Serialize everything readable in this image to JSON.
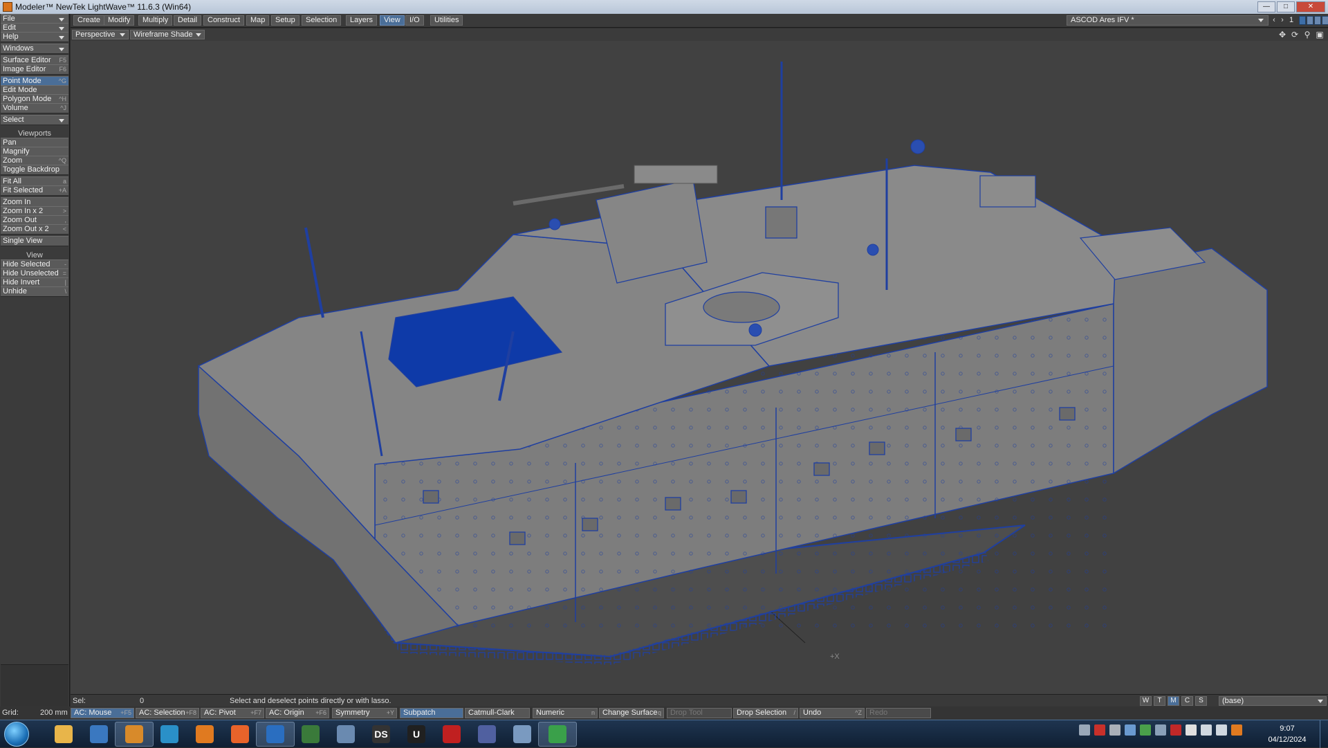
{
  "window": {
    "title": "Modeler™ NewTek LightWave™ 11.6.3 (Win64)",
    "controls": [
      "minimize",
      "maximize",
      "close"
    ]
  },
  "left_toolbar": {
    "menus": [
      {
        "label": "File"
      },
      {
        "label": "Edit"
      },
      {
        "label": "Help"
      },
      {
        "label": "Windows"
      }
    ],
    "editors": [
      {
        "label": "Surface Editor",
        "key": "F5"
      },
      {
        "label": "Image Editor",
        "key": "F6"
      }
    ],
    "modes": [
      {
        "label": "Point Mode",
        "key": "^G",
        "active": true
      },
      {
        "label": "Edit Mode",
        "key": ""
      },
      {
        "label": "Polygon Mode",
        "key": "^H"
      },
      {
        "label": "Volume",
        "key": "^J"
      }
    ],
    "select_label": "Select",
    "viewports_header": "Viewports",
    "viewport_tools": [
      {
        "label": "Pan",
        "key": ""
      },
      {
        "label": "Magnify",
        "key": ""
      },
      {
        "label": "Zoom",
        "key": "^Q"
      },
      {
        "label": "Toggle Backdrop",
        "key": ""
      }
    ],
    "fit_tools": [
      {
        "label": "Fit All",
        "key": "a"
      },
      {
        "label": "Fit Selected",
        "key": "+A"
      }
    ],
    "zoom_tools": [
      {
        "label": "Zoom In",
        "key": ""
      },
      {
        "label": "Zoom In x 2",
        "key": ">"
      },
      {
        "label": "Zoom Out",
        "key": ","
      },
      {
        "label": "Zoom Out x 2",
        "key": "<"
      }
    ],
    "single_view": "Single View",
    "view_header": "View",
    "view_tools": [
      {
        "label": "Hide Selected",
        "key": "-"
      },
      {
        "label": "Hide Unselected",
        "key": "="
      },
      {
        "label": "Hide Invert",
        "key": "|"
      },
      {
        "label": "Unhide",
        "key": "\\"
      }
    ]
  },
  "menu_tabs": [
    {
      "label": "Create"
    },
    {
      "label": "Modify"
    },
    {
      "label": "Multiply"
    },
    {
      "label": "Detail"
    },
    {
      "label": "Construct"
    },
    {
      "label": "Map"
    },
    {
      "label": "Setup"
    },
    {
      "label": "Selection"
    },
    {
      "label": "Layers"
    },
    {
      "label": "View",
      "active": true
    },
    {
      "label": "I/O"
    },
    {
      "label": "Utilities"
    }
  ],
  "object_selector": "ASCOD Ares IFV *",
  "layer_bank_number": "1",
  "viewport": {
    "view_type": "Perspective",
    "render_mode": "Wireframe Shade",
    "axis_label": "+X"
  },
  "status": {
    "sel_label": "Sel:",
    "sel_value": "0",
    "message": "Select and deselect points directly or with lasso.",
    "view_toggles": [
      "W",
      "T",
      "M",
      "C",
      "S"
    ],
    "active_toggle": "M",
    "layer_name": "(base)"
  },
  "bottom_toolbar": {
    "grid_label": "Grid:",
    "grid_value": "200 mm",
    "buttons": [
      {
        "label": "AC: Mouse",
        "key": "+F5",
        "active": true
      },
      {
        "label": "AC: Selection",
        "key": "+F8"
      },
      {
        "label": "AC: Pivot",
        "key": "+F7"
      },
      {
        "label": "AC: Origin",
        "key": "+F6"
      },
      {
        "label": "Symmetry",
        "key": "+Y"
      },
      {
        "label": "Subpatch",
        "key": "",
        "active": true
      },
      {
        "label": "Catmull-Clark",
        "key": ""
      },
      {
        "label": "Numeric",
        "key": "n"
      },
      {
        "label": "Change Surface",
        "key": "q"
      },
      {
        "label": "Drop Tool",
        "key": "",
        "disabled": true
      },
      {
        "label": "Drop Selection",
        "key": "/"
      },
      {
        "label": "Undo",
        "key": "^Z"
      },
      {
        "label": "Redo",
        "key": "",
        "disabled": true
      }
    ]
  },
  "taskbar": {
    "apps": [
      {
        "name": "file-explorer",
        "glyph": "",
        "color": "#e8b54a"
      },
      {
        "name": "photo-viewer",
        "glyph": "",
        "color": "#3a78c0"
      },
      {
        "name": "lightwave-layout",
        "glyph": "",
        "color": "#d88a2a",
        "open": true
      },
      {
        "name": "blender-like",
        "glyph": "",
        "color": "#2a90c8"
      },
      {
        "name": "photoshop-like",
        "glyph": "",
        "color": "#e07a20"
      },
      {
        "name": "firefox",
        "glyph": "",
        "color": "#e8632a"
      },
      {
        "name": "photoshop",
        "glyph": "",
        "color": "#2a6ec0",
        "open": true
      },
      {
        "name": "terminal",
        "glyph": "",
        "color": "#3a7a3a"
      },
      {
        "name": "calculator",
        "glyph": "",
        "color": "#6a8ab0"
      },
      {
        "name": "daz-studio",
        "glyph": "DS",
        "color": "#333333"
      },
      {
        "name": "unreal",
        "glyph": "U",
        "color": "#202020"
      },
      {
        "name": "zbrush-like",
        "glyph": "",
        "color": "#c02020"
      },
      {
        "name": "substance",
        "glyph": "",
        "color": "#5060a0"
      },
      {
        "name": "paint-app",
        "glyph": "",
        "color": "#7a9ac0"
      },
      {
        "name": "chrome",
        "glyph": "",
        "color": "#3aa04a",
        "open": true
      }
    ],
    "clock_time": "9:07",
    "clock_date": "04/12/2024"
  },
  "colors": {
    "accent": "#4a6e98",
    "wire": "#1f3fa0",
    "model_fill": "#7d7d7d",
    "viewport_bg": "#414141"
  }
}
